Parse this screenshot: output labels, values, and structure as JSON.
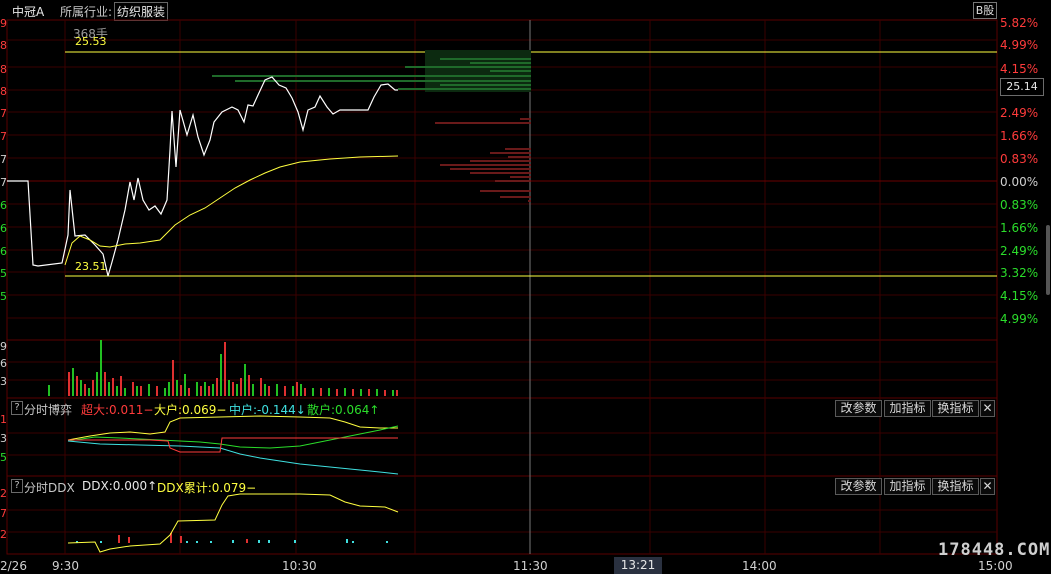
{
  "header": {
    "stock_name": "中冠A",
    "industry_label": "所属行业:",
    "industry_value": "纺织服装",
    "b_share": "B股"
  },
  "price_chart": {
    "high_label": "25.53",
    "low_label": "23.51",
    "volume_top_label": "368手",
    "current_price": "25.14",
    "right_pct_labels": [
      {
        "text": "5.82%",
        "color": "#ff3b3b"
      },
      {
        "text": "4.99%",
        "color": "#ff3b3b"
      },
      {
        "text": "4.15%",
        "color": "#ff3b3b"
      },
      {
        "text": "2.49%",
        "color": "#ff3b3b"
      },
      {
        "text": "1.66%",
        "color": "#ff3b3b"
      },
      {
        "text": "0.83%",
        "color": "#ff3b3b"
      },
      {
        "text": "0.00%",
        "color": "#d0d0d0"
      },
      {
        "text": "0.83%",
        "color": "#2bdd2b"
      },
      {
        "text": "1.66%",
        "color": "#2bdd2b"
      },
      {
        "text": "2.49%",
        "color": "#2bdd2b"
      },
      {
        "text": "3.32%",
        "color": "#2bdd2b"
      },
      {
        "text": "4.15%",
        "color": "#2bdd2b"
      },
      {
        "text": "4.99%",
        "color": "#2bdd2b"
      }
    ],
    "left_edge_digits": [
      "9",
      "8",
      "8",
      "8",
      "7",
      "7",
      "7",
      "7",
      "6",
      "6",
      "6",
      "5",
      "5"
    ]
  },
  "volume": {
    "left_edge_digits": [
      "9",
      "6",
      "3"
    ]
  },
  "game_panel": {
    "title": "分时博弈",
    "super_label": "超大:0.011",
    "super_arrow": "−",
    "large_label": "大户:0.069",
    "large_arrow": "−",
    "mid_label": "中户:-0.144",
    "mid_arrow": "↓",
    "retail_label": "散户:0.064",
    "retail_arrow": "↑",
    "btn_params": "改参数",
    "btn_add": "加指标",
    "btn_switch": "换指标",
    "left_edge_digits": [
      "1",
      "3",
      "5"
    ]
  },
  "ddx_panel": {
    "title": "分时DDX",
    "ddx_label": "DDX:0.000",
    "ddx_arrow": "↑",
    "ddx_cum_label": "DDX累计:0.079",
    "ddx_cum_arrow": "−",
    "btn_params": "改参数",
    "btn_add": "加指标",
    "btn_switch": "换指标",
    "left_edge_digits": [
      "2",
      "7",
      "2"
    ]
  },
  "time_axis": {
    "labels": [
      "2/26",
      "9:30",
      "10:30",
      "11:30",
      "14:00",
      "15:00"
    ],
    "cursor_time": "13:21"
  },
  "watermark": "178448.COM",
  "colors": {
    "grid": "#3a0000",
    "price_line": "#ffffff",
    "avg_line": "#ffff40",
    "up": "#ff3b3b",
    "down": "#2bdd2b",
    "cyan": "#3fe0e0",
    "yellow": "#ffff40"
  }
}
